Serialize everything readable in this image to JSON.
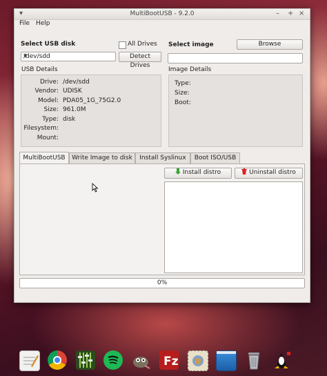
{
  "window": {
    "title": "MultiBootUSB - 9.2.0",
    "controls": [
      "▾",
      "–",
      "+",
      "×"
    ]
  },
  "menu": [
    {
      "label": "File"
    },
    {
      "label": "Help"
    }
  ],
  "usb": {
    "heading": "Select USB disk",
    "selected_disk": "/dev/sdd",
    "all_drives_label": "All Drives",
    "all_drives_checked": false,
    "detect_button": "Detect Drives",
    "details_heading": "USB Details",
    "details": [
      {
        "label": "Drive:",
        "value": "/dev/sdd"
      },
      {
        "label": "Vendor:",
        "value": "UDISK"
      },
      {
        "label": "Model:",
        "value": "PDA05_1G_75G2.0"
      },
      {
        "label": "Size:",
        "value": "961.0M"
      },
      {
        "label": "Type:",
        "value": "disk"
      },
      {
        "label": "Filesystem:",
        "value": ""
      },
      {
        "label": "Mount:",
        "value": ""
      }
    ]
  },
  "image": {
    "heading": "Select image",
    "browse_button": "Browse",
    "path_value": "",
    "details_heading": "Image Details",
    "details": [
      {
        "label": "Type:",
        "value": ""
      },
      {
        "label": "Size:",
        "value": ""
      },
      {
        "label": "Boot:",
        "value": ""
      }
    ]
  },
  "tabs": [
    {
      "label": "MultiBootUSB",
      "active": true
    },
    {
      "label": "Write Image to disk",
      "active": false
    },
    {
      "label": "Install Syslinux",
      "active": false
    },
    {
      "label": "Boot ISO/USB",
      "active": false
    }
  ],
  "distro": {
    "install_button": "Install distro",
    "uninstall_button": "Uninstall distro",
    "install_icon": "green-down-arrow-icon",
    "uninstall_icon": "trash-icon"
  },
  "progress": {
    "text": "0%",
    "value": 0
  },
  "dock": [
    {
      "icon": "text-editor-icon"
    },
    {
      "icon": "chrome-icon"
    },
    {
      "icon": "mixer-icon"
    },
    {
      "icon": "spotify-icon"
    },
    {
      "icon": "gimp-icon"
    },
    {
      "icon": "filezilla-icon"
    },
    {
      "icon": "mail-stamp-icon"
    },
    {
      "icon": "desktop-icon"
    },
    {
      "icon": "trash-icon"
    },
    {
      "icon": "multibootusb-icon"
    }
  ]
}
